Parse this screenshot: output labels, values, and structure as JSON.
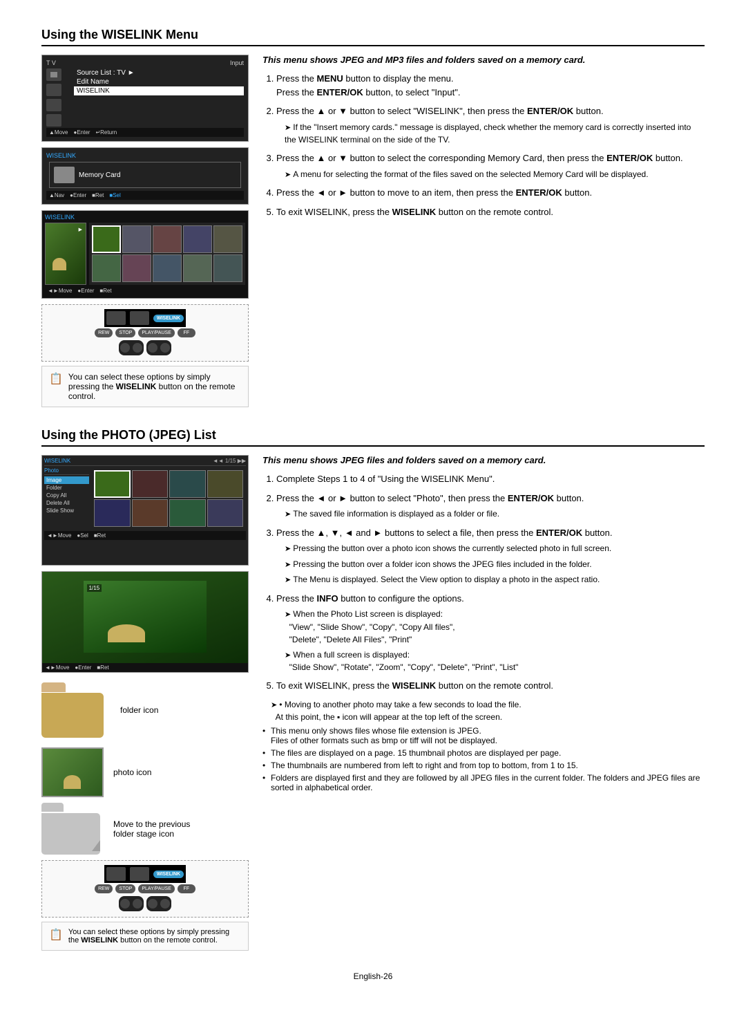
{
  "wiselink_section": {
    "title": "Using the WISELINK Menu",
    "intro_italic": "This menu shows JPEG and MP3 files and folders saved on a memory card.",
    "steps": [
      {
        "num": "1.",
        "text": "Press the ",
        "bold": "MENU",
        "text2": " button to display the menu.",
        "line2": "Press the ",
        "bold2": "ENTER/OK",
        "text3": " button, to select \"Input\"."
      },
      {
        "num": "2.",
        "text": "Press the ▲ or ▼ button to select \"WISELINK\", then press the ",
        "bold": "ENTER/OK",
        "text2": " button."
      },
      {
        "num": "3.",
        "indent": "If the \"Insert memory cards.\" message is displayed, check whether the memory card is correctly inserted into the WISELINK terminal on the side of the TV.",
        "text": "Press the ▲ or ▼ button to select the corresponding Memory Card, then press the ",
        "bold": "ENTER/OK",
        "text2": " button.",
        "indent2": "A menu for selecting the format of the files saved on the selected Memory Card will be displayed."
      },
      {
        "num": "4.",
        "text": "Press the ◄ or ► button to move to an item, then press the ",
        "bold": "ENTER/OK",
        "text2": " button."
      },
      {
        "num": "5.",
        "text": "To exit WISELINK, press the ",
        "bold": "WISELINK",
        "text2": " button on the remote control."
      }
    ],
    "note": "You can select these options by simply pressing the WISELINK button on the remote control.",
    "note_bold": "WISELINK",
    "tv_screens": [
      {
        "label": "TV / Input menu",
        "items": [
          "Source List : TV",
          "Edit Name",
          "WISELINK"
        ],
        "bottom": "▲Move  ●Enter  ↵Return"
      },
      {
        "label": "WISELINK memory card",
        "content": "Memory Card"
      },
      {
        "label": "Photo selection"
      }
    ]
  },
  "photo_section": {
    "title": "Using the PHOTO (JPEG) List",
    "intro_italic": "This menu shows JPEG files and folders saved on a memory card.",
    "steps": [
      {
        "num": "1.",
        "text": "Complete Steps 1 to 4 of \"Using the WISELINK Menu\"."
      },
      {
        "num": "2.",
        "text": "Press the ◄ or ► button to select \"Photo\", then press the ",
        "bold": "ENTER/OK",
        "text2": " button.",
        "indent": "The saved file information is displayed as a folder or file."
      },
      {
        "num": "3.",
        "text": "Press the ▲, ▼, ◄ and ► buttons to select a file, then press the ",
        "bold": "ENTER/OK",
        "text2": " button.",
        "indents": [
          "Pressing the button over a photo icon shows the currently selected photo in full screen.",
          "Pressing the button over a folder icon shows the JPEG files included in the folder.",
          "The Menu is displayed. Select the View option to display a photo in the aspect ratio."
        ]
      },
      {
        "num": "4.",
        "text": "Press the ",
        "bold": "INFO",
        "text2": " button to configure the options.",
        "indents": [
          "When the Photo List screen is displayed:",
          "\"View\", \"Slide Show\", \"Copy\", \"Copy All files\", \"Delete\", \"Delete All Files\", \"Print\"",
          "When a full screen is displayed:",
          "\"Slide Show\", \"Rotate\", \"Zoom\", \"Copy\", \"Delete\", \"Print\", \"List\""
        ]
      },
      {
        "num": "5.",
        "text": "To exit WISELINK, press the ",
        "bold": "WISELINK",
        "text2": " button on the remote control."
      }
    ],
    "arrow_note_1": "• Moving to another photo may take a few seconds to load the file. At this point, the  icon will appear at the top left of the screen.",
    "bullets": [
      "This menu only shows files whose file extension is JPEG. Files of other formats such as bmp or tiff will not be displayed.",
      "The files are displayed on a page. 15 thumbnail photos are displayed per page.",
      "The thumbnails are numbered from left to right and from top to bottom, from 1 to 15.",
      "Folders are displayed first and they are followed by all JPEG files in the current folder. The folders and JPEG files are sorted in alphabetical order."
    ],
    "icon_folder_label": "folder icon",
    "icon_photo_label": "photo icon",
    "icon_prev_folder_label": "Move to the previous folder stage icon",
    "note": "You can select these options by simply pressing the ",
    "note_bold": "WISELINK",
    "note2": " button on the remote control."
  },
  "page_number": "English-26",
  "remote": {
    "wiselink_label": "WISELINK",
    "rew_label": "REW",
    "stop_label": "STOP",
    "play_label": "PLAY/PAUSE",
    "ff_label": "FF"
  }
}
